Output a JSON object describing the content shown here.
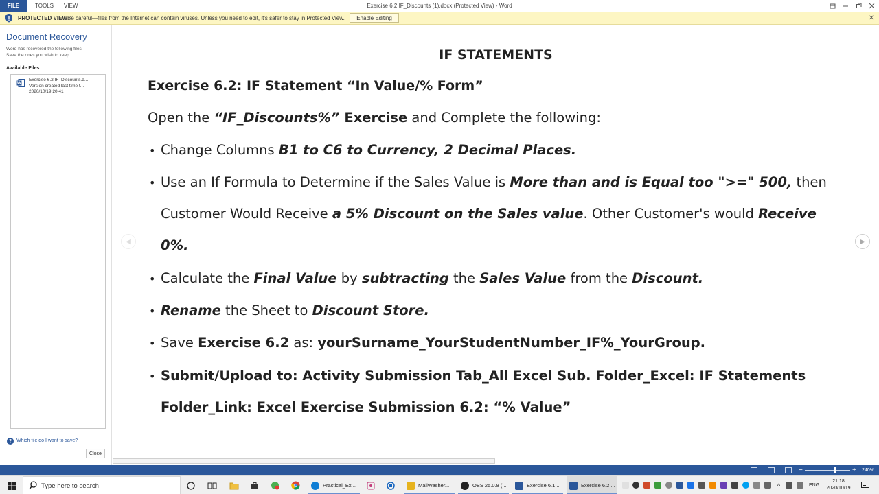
{
  "titlebar": {
    "file_label": "FILE",
    "tools_label": "TOOLS",
    "view_label": "VIEW",
    "window_title": "Exercise 6.2 IF_Discounts (1).docx (Protected View) - Word"
  },
  "protected_bar": {
    "label": "PROTECTED VIEW",
    "message": "Be careful—files from the Internet can contain viruses. Unless you need to edit, it's safer to stay in Protected View.",
    "button": "Enable Editing"
  },
  "recovery": {
    "title": "Document Recovery",
    "desc_line1": "Word has recovered the following files.",
    "desc_line2": "Save the ones you wish to keep.",
    "available_label": "Available Files",
    "file": {
      "name": "Exercise 6.2 IF_Discounts.d...",
      "version": "Version created last time t...",
      "date": "2020/10/19 20:41"
    },
    "help_link": "Which file do I want to save?",
    "close_button": "Close"
  },
  "document": {
    "title": "IF STATEMENTS",
    "exercise_heading": "Exercise 6.2: IF Statement “In Value/% Form”",
    "intro": {
      "t1": "Open the ",
      "t2": "“IF_Discounts%”",
      "t3": " Exercise",
      "t4": " and Complete the following:"
    },
    "b1": {
      "t1": "Change Columns ",
      "t2": "B1 to C6 to Currency, 2 Decimal Places."
    },
    "b2": {
      "t1": "Use an If Formula to Determine if the Sales Value is ",
      "t2": "More than and is Equal too \">=\" 500,",
      "t3": " then",
      "t4": "Customer Would Receive ",
      "t5": "a 5% Discount on the Sales value",
      "t6": ". Other Customer's would ",
      "t7": "Receive",
      "t8": "0%."
    },
    "b3": {
      "t1": "Calculate the ",
      "t2": "Final Value",
      "t3": " by ",
      "t4": "subtracting",
      "t5": " the ",
      "t6": "Sales Value",
      "t7": " from the ",
      "t8": "Discount."
    },
    "b4": {
      "t1": "Rename",
      "t2": " the Sheet to ",
      "t3": "Discount Store."
    },
    "b5": {
      "t1": "Save ",
      "t2": "Exercise 6.2",
      "t3": " as: ",
      "t4": "yourSurname_YourStudentNumber_IF%_YourGroup."
    },
    "b6": {
      "t1": "Submit/Upload to: Activity Submission Tab_All Excel Sub. Folder_Excel: IF Statements",
      "t2": "Folder_Link: Excel Exercise Submission 6.2: “% Value”"
    },
    "bullet": "•"
  },
  "statusbar": {
    "zoom": "240%",
    "zoom_level": 0.66
  },
  "taskbar": {
    "search_placeholder": "Type here to search",
    "apps": [
      {
        "label": "Practical_Ex...",
        "color": "#0f7dd4"
      },
      {
        "label": "MailWasher...",
        "color": "#e6b31e"
      },
      {
        "label": "OBS 25.0.8 (...",
        "color": "#222222"
      },
      {
        "label": "Exercise 6.1 ...",
        "color": "#2b579a"
      },
      {
        "label": "Exercise 6.2 ...",
        "color": "#2b579a"
      }
    ],
    "lang": "ENG",
    "time": "21:18",
    "date": "2020/10/19"
  },
  "colors": {
    "word_blue": "#2b579a",
    "protected_yellow": "#fdf6c3"
  }
}
